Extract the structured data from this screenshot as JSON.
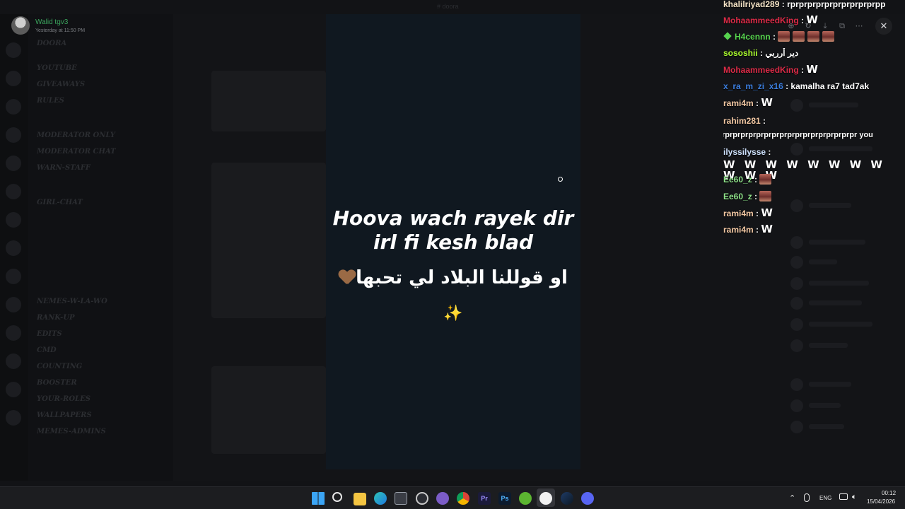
{
  "window": {
    "top_title": "# doora"
  },
  "uploader": {
    "name": "Walid tgv3",
    "timestamp": "Yesterday at 11:50 PM"
  },
  "video": {
    "line1": "Hoova wach rayek dir",
    "line2": "irl fi kesh blad",
    "arabic": "او قوللنا البلاد لي تحبها",
    "sparkle": "✨"
  },
  "viewer_toolbar": {
    "icons": [
      "zoom-icon",
      "rotate-icon",
      "download-icon",
      "open-external-icon",
      "more-icon"
    ],
    "close_label": "✕"
  },
  "live_chat": {
    "messages": [
      {
        "user": "khalilriyad289",
        "color": "#f4e3c6",
        "text": "rprprprprprprprprprprpp"
      },
      {
        "user": "MohaammeedKing",
        "color": "#dc2b47",
        "text": "W"
      },
      {
        "user": "H4cennn",
        "color": "#57d44f",
        "text": "",
        "emotes": 4
      },
      {
        "user": "sososhii",
        "color": "#adff2f",
        "text": "دير أرربي"
      },
      {
        "user": "MohaammeedKing",
        "color": "#dc2b47",
        "text": "W"
      },
      {
        "user": "x_ra_m_zi_x16",
        "color": "#3c7fe0",
        "text": "kamalha ra7 tad7ak"
      },
      {
        "user": "rami4m",
        "color": "#f4c9a4",
        "text": "W"
      },
      {
        "user": "rahim281",
        "color": "#f4c9a4",
        "text": "rprprprprprprprprprprprprprprprprpr you"
      },
      {
        "user": "ilyssilysse",
        "color": "#cfe3ff",
        "text": "W W W W W W W W W W W"
      },
      {
        "user": "Ee60_z",
        "color": "#8fe38a",
        "text": "",
        "emotes": 1
      },
      {
        "user": "Ee60_z",
        "color": "#8fe38a",
        "text": "",
        "emotes": 1
      },
      {
        "user": "rami4m",
        "color": "#f4c9a4",
        "text": "W"
      },
      {
        "user": "rami4m",
        "color": "#f4c9a4",
        "text": "W"
      }
    ]
  },
  "backdrop": {
    "channels": [
      "DOORA",
      "YOUTUBE",
      "GIVEAWAYS",
      "RULES",
      "MODERATOR ONLY",
      "MODERATOR CHAT",
      "WARN-STAFF",
      "GIRL-CHAT",
      "NEMES-W-LA-WO",
      "RANK-UP",
      "EDITS",
      "CMD",
      "COUNTING",
      "BOOSTER",
      "YOUR-ROLES",
      "WALLPAPERS",
      "MEMES-ADMINS"
    ]
  },
  "taskbar": {
    "language": "ENG",
    "time": "00:12",
    "date": "15/04/2026"
  }
}
